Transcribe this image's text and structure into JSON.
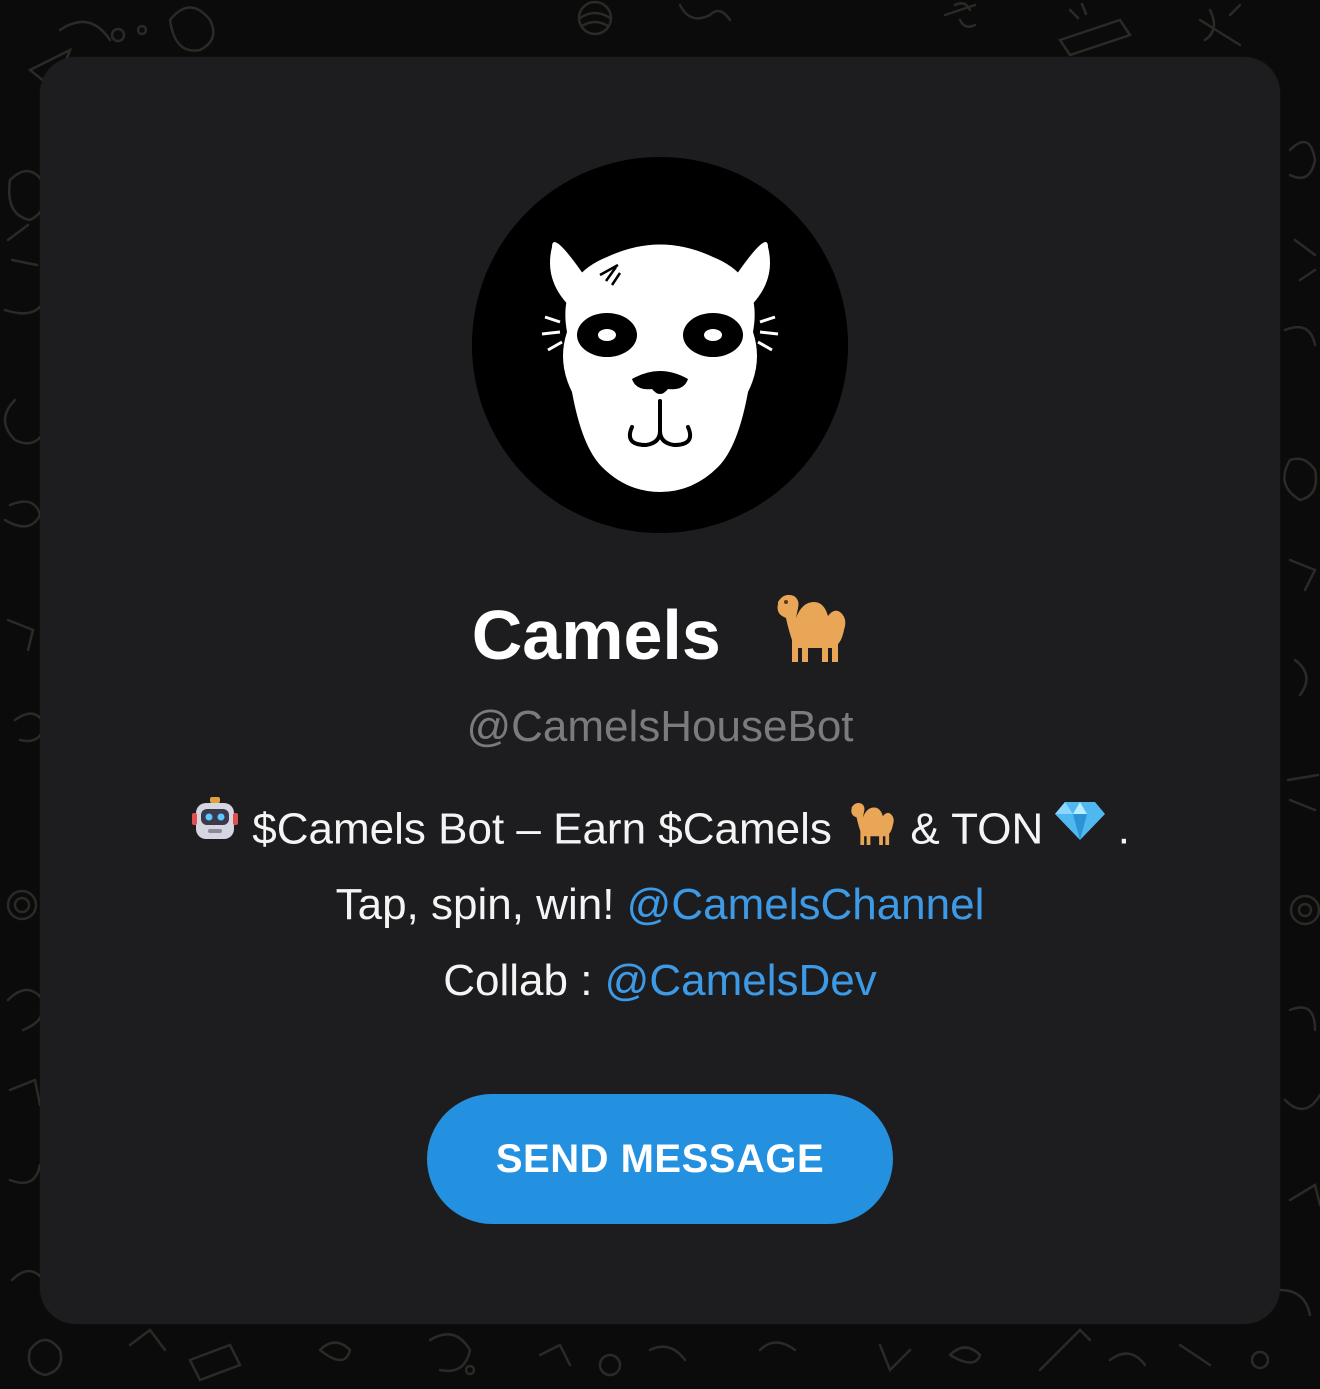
{
  "profile": {
    "name": "Camels",
    "username": "@CamelsHouseBot",
    "avatar_icon": "camel-face-icon",
    "name_emoji": "camel-emoji-icon"
  },
  "description": {
    "line1": {
      "robot_icon": "robot-emoji-icon",
      "text_a": "$Camels Bot – Earn $Camels",
      "camel_icon": "camel-emoji-icon",
      "text_b": "& TON",
      "gem_icon": "gem-emoji-icon",
      "text_c": "."
    },
    "line2": {
      "text": "Tap, spin, win!",
      "link": "@CamelsChannel"
    },
    "line3": {
      "text": "Collab :",
      "link": "@CamelsDev"
    }
  },
  "actions": {
    "send_message_label": "SEND MESSAGE"
  },
  "colors": {
    "card_background": "#1d1d1f",
    "link": "#3c9ae6",
    "button": "#2491e0",
    "username": "#7b7b7e",
    "page_background": "#0b0b0b"
  }
}
